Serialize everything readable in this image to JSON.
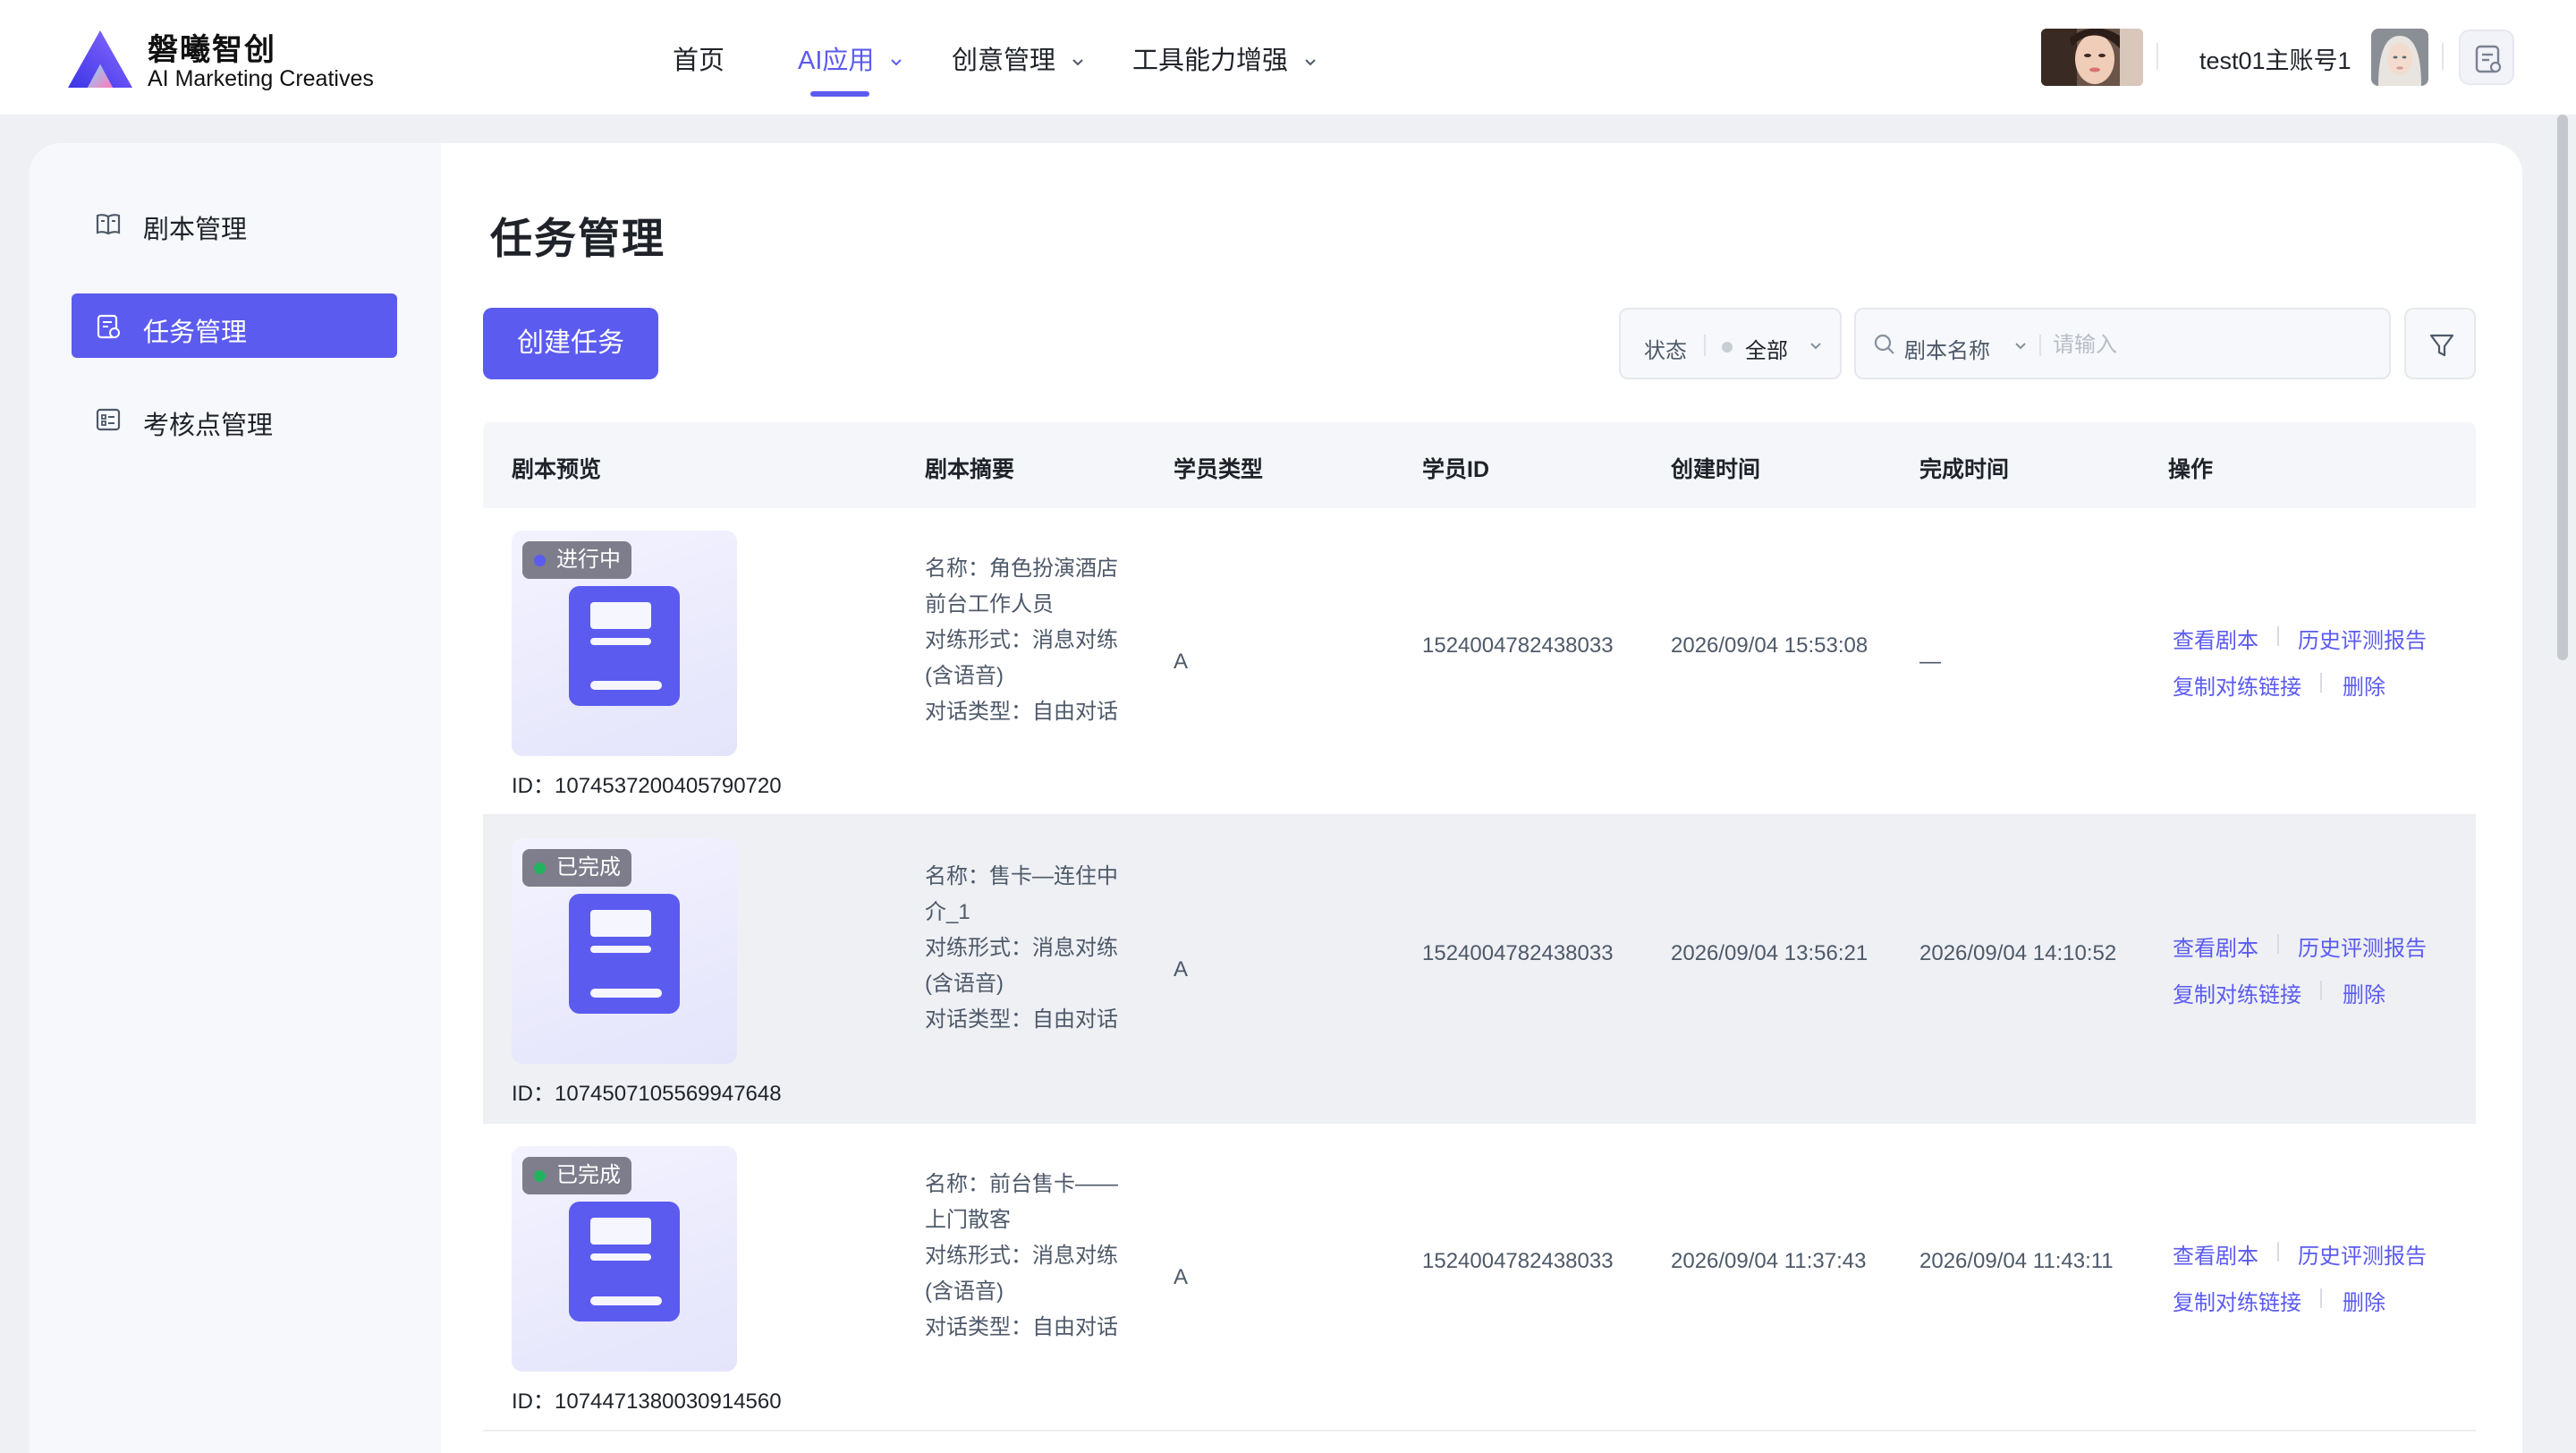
{
  "brand": {
    "name_cn": "磐曦智创",
    "name_en": "AI Marketing Creatives"
  },
  "nav": [
    {
      "label": "首页",
      "dropdown": false,
      "active": false
    },
    {
      "label": "AI应用",
      "dropdown": true,
      "active": true
    },
    {
      "label": "创意管理",
      "dropdown": true,
      "active": false
    },
    {
      "label": "工具能力增强",
      "dropdown": true,
      "active": false
    }
  ],
  "user": {
    "name": "test01主账号1"
  },
  "colors": {
    "accent": "#5b5bf0",
    "running": "#5b5bf0",
    "done": "#22b35e"
  },
  "sidebar": {
    "items": [
      {
        "label": "剧本管理",
        "icon": "book-icon",
        "active": false
      },
      {
        "label": "任务管理",
        "icon": "task-list-icon",
        "active": true
      },
      {
        "label": "考核点管理",
        "icon": "checklist-icon",
        "active": false
      }
    ]
  },
  "main": {
    "title": "任务管理",
    "create_button": "创建任务",
    "filter_status": {
      "label": "状态",
      "value": "全部"
    },
    "search": {
      "field": "剧本名称",
      "placeholder": "请输入"
    }
  },
  "table": {
    "columns": [
      "剧本预览",
      "剧本摘要",
      "学员类型",
      "学员ID",
      "创建时间",
      "完成时间",
      "操作"
    ],
    "rows": [
      {
        "status": "进行中",
        "status_color": "#5b5bf0",
        "id": "ID：1074537200405790720",
        "summary": [
          "名称：角色扮演酒店前台工作人员",
          "对练形式：消息对练(含语音)",
          "对话类型：自由对话"
        ],
        "student_type": "A",
        "student_id": "1524004782438033",
        "created": "2026/09/04 15:53:08",
        "finished": "—",
        "ops": [
          "查看剧本",
          "历史评测报告",
          "复制对练链接",
          "删除"
        ]
      },
      {
        "status": "已完成",
        "status_color": "#22b35e",
        "id": "ID：1074507105569947648",
        "summary": [
          "名称：售卡—连住中介_1",
          "对练形式：消息对练(含语音)",
          "对话类型：自由对话"
        ],
        "student_type": "A",
        "student_id": "1524004782438033",
        "created": "2026/09/04 13:56:21",
        "finished": "2026/09/04 14:10:52",
        "ops": [
          "查看剧本",
          "历史评测报告",
          "复制对练链接",
          "删除"
        ]
      },
      {
        "status": "已完成",
        "status_color": "#22b35e",
        "id": "ID：1074471380030914560",
        "summary": [
          "名称：前台售卡——上门散客",
          "对练形式：消息对练(含语音)",
          "对话类型：自由对话"
        ],
        "student_type": "A",
        "student_id": "1524004782438033",
        "created": "2026/09/04 11:37:43",
        "finished": "2026/09/04 11:43:11",
        "ops": [
          "查看剧本",
          "历史评测报告",
          "复制对练链接",
          "删除"
        ]
      }
    ]
  }
}
